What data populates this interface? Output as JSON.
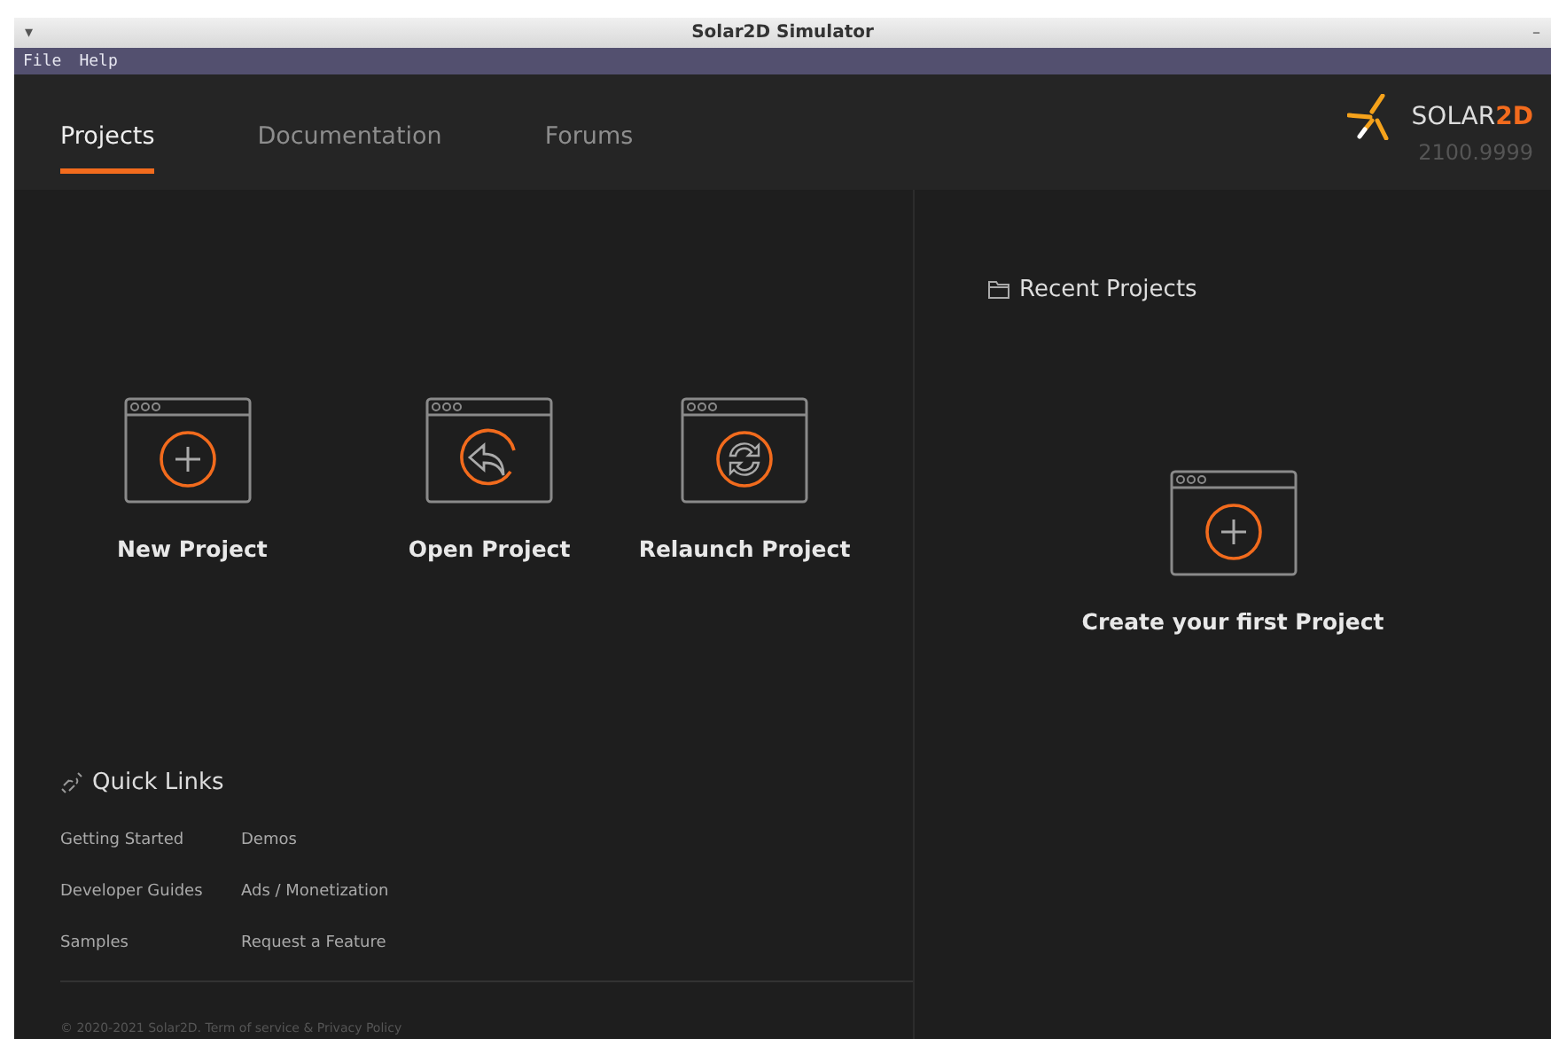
{
  "window": {
    "title": "Solar2D Simulator",
    "menu_glyph": "▾",
    "minimize_glyph": "–"
  },
  "menu": [
    "File",
    "Help"
  ],
  "tabs": [
    {
      "label": "Projects",
      "selected": true
    },
    {
      "label": "Documentation",
      "selected": false
    },
    {
      "label": "Forums",
      "selected": false
    }
  ],
  "logo": {
    "name_plain": "SOLAR",
    "name_accent": "2D",
    "version": "2100.9999"
  },
  "actions": [
    {
      "kind": "new",
      "label": "New Project"
    },
    {
      "kind": "open",
      "label": "Open Project"
    },
    {
      "kind": "relaunch",
      "label": "Relaunch Project"
    }
  ],
  "quick_links": {
    "title": "Quick Links",
    "columns": [
      [
        "Getting Started",
        "Developer Guides",
        "Samples"
      ],
      [
        "Demos",
        "Ads / Monetization",
        "Request a Feature"
      ]
    ]
  },
  "footer": "© 2020-2021 Solar2D. Term of service  & Privacy Policy",
  "recent": {
    "title": "Recent Projects",
    "empty_label": "Create your first Project"
  }
}
